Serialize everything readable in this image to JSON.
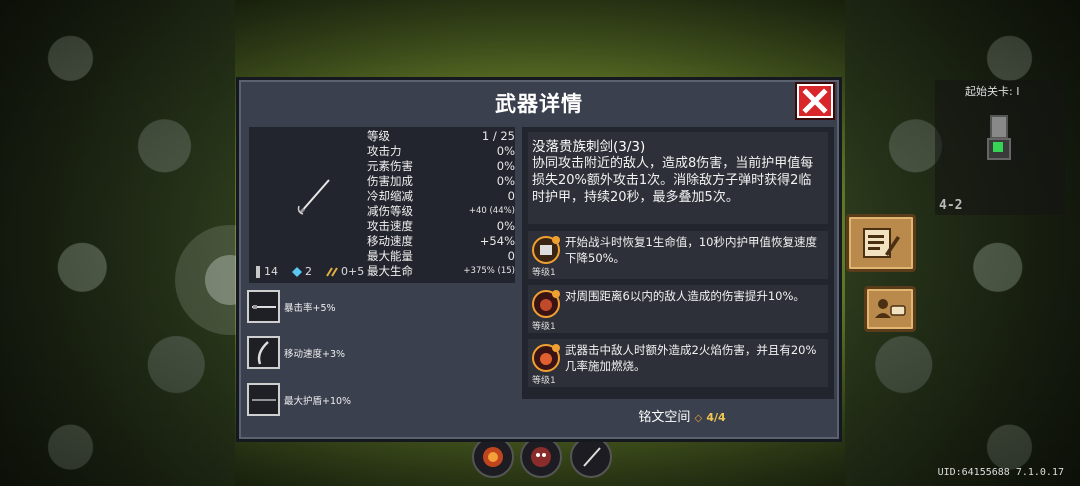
{
  "dialog": {
    "title": "武器详情",
    "close_icon": "close-icon"
  },
  "stats": [
    {
      "label": "等级",
      "value": "1 / 25",
      "small": false
    },
    {
      "label": "攻击力",
      "value": "0%",
      "small": false
    },
    {
      "label": "元素伤害",
      "value": "0%",
      "small": false
    },
    {
      "label": "伤害加成",
      "value": "0%",
      "small": false
    },
    {
      "label": "冷却缩减",
      "value": "0",
      "small": false
    },
    {
      "label": "减伤等级",
      "value": "+40 (44%)",
      "small": true
    },
    {
      "label": "攻击速度",
      "value": "0%",
      "small": false
    },
    {
      "label": "移动速度",
      "value": "+54%",
      "small": false
    },
    {
      "label": "最大能量",
      "value": "0",
      "small": false
    },
    {
      "label": "最大生命",
      "value": "+375% (15)",
      "small": true
    }
  ],
  "resources": {
    "material1": "14",
    "gem": "2",
    "upgrade": "0+5"
  },
  "bonuses": [
    {
      "label": "暴击率+5%"
    },
    {
      "label": "移动速度+3%"
    },
    {
      "label": "最大护盾+10%"
    }
  ],
  "weapon": {
    "name": "没落贵族刺剑(3/3)",
    "description": "协同攻击附近的敌人，造成8伤害，当前护甲值每损失20%额外攻击1次。消除敌方子弹时获得2临时护甲，持续20秒，最多叠加5次。"
  },
  "inscriptions": [
    {
      "text": "开始战斗时恢复1生命值，10秒内护甲值恢复速度下降50%。",
      "level": "等级1"
    },
    {
      "text": "对周围距离6以内的敌人造成的伤害提升10%。",
      "level": "等级1"
    },
    {
      "text": "武器击中敌人时额外造成2火焰伤害，并且有20%几率施加燃烧。",
      "level": "等级1"
    }
  ],
  "inscription_slots": {
    "label": "铭文空间",
    "count": "4/4"
  },
  "minimap": {
    "label": "起始关卡: I",
    "level": "4-2"
  },
  "uid": "UID:64155688 7.1.0.17",
  "colors": {
    "dialog_bg": "#3b404e",
    "panel_bg": "#23252e",
    "close_red": "#d8262a",
    "accent_gold": "#f0c850"
  }
}
